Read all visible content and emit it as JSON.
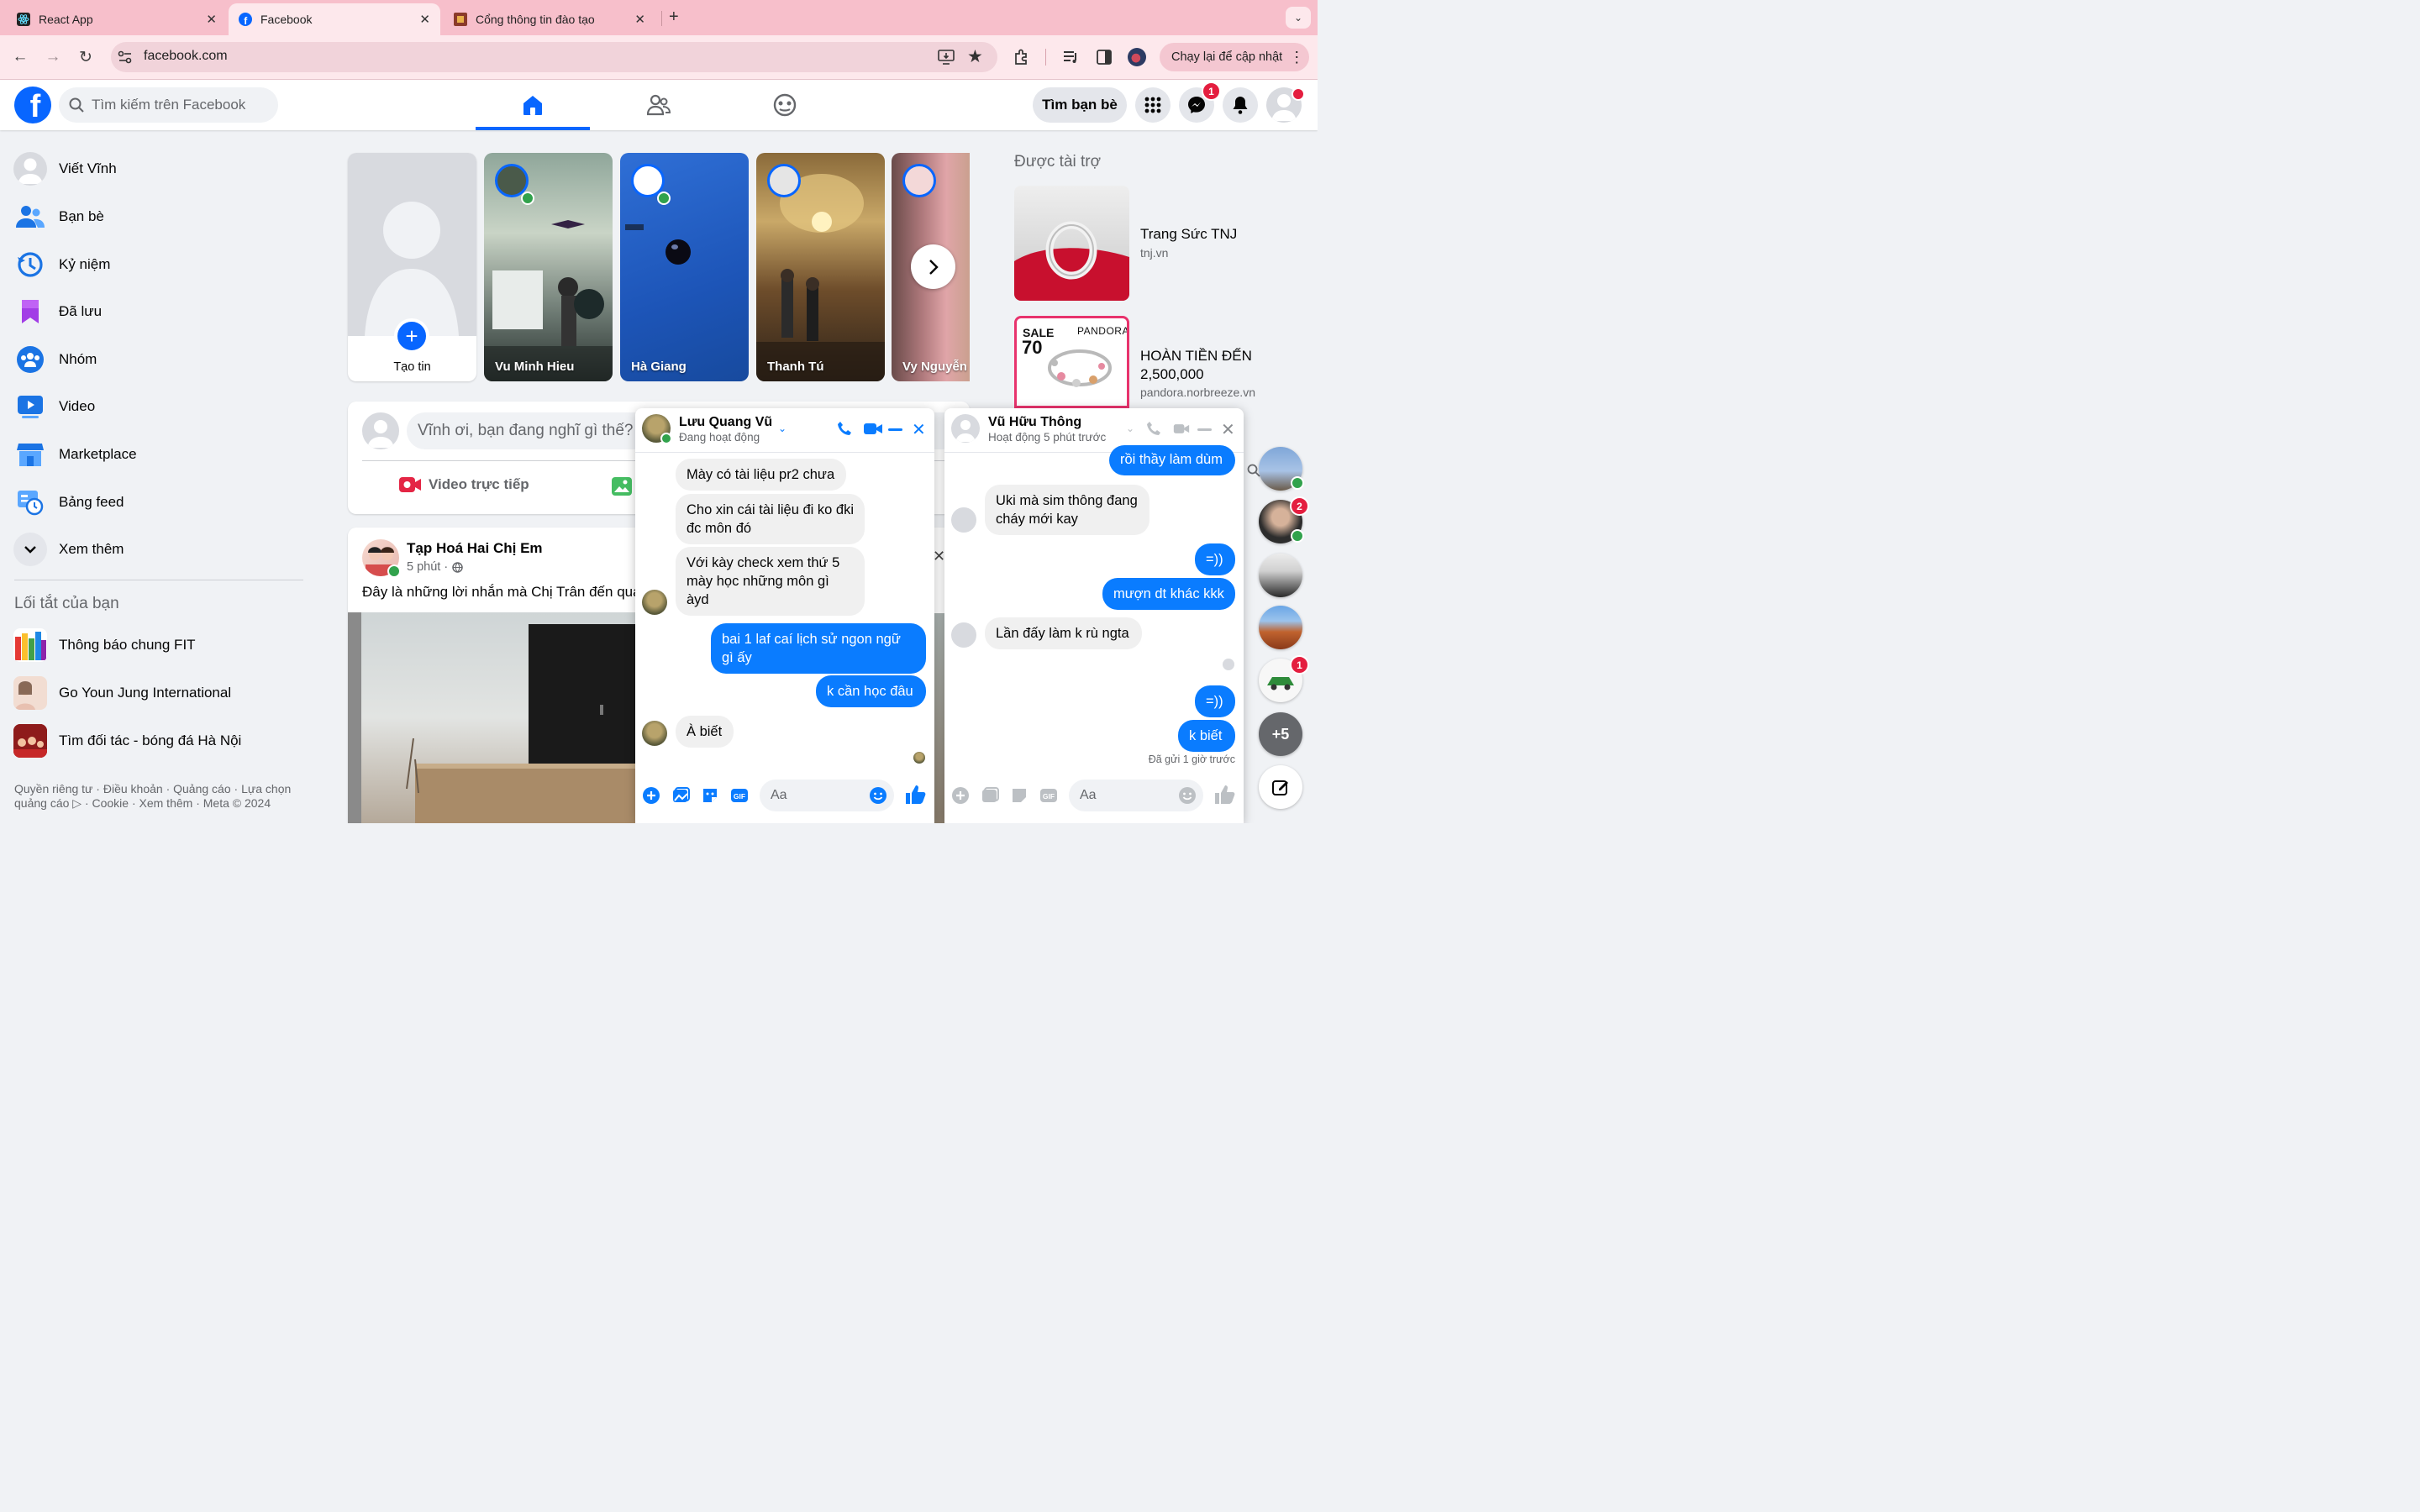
{
  "browser": {
    "tabs": [
      {
        "title": "React App",
        "active": false
      },
      {
        "title": "Facebook",
        "active": true
      },
      {
        "title": "Cổng thông tin đào tạo",
        "active": false
      }
    ],
    "url": "facebook.com",
    "relaunch_label": "Chạy lại để cập nhật"
  },
  "header": {
    "search_placeholder": "Tìm kiếm trên Facebook",
    "find_friends_label": "Tìm bạn bè",
    "messenger_badge": "1",
    "accent": "#0866ff"
  },
  "sidebar": {
    "items": [
      {
        "label": "Viết Vĩnh",
        "icon": "avatar"
      },
      {
        "label": "Bạn bè",
        "icon": "friends-icon"
      },
      {
        "label": "Kỷ niệm",
        "icon": "memories-icon"
      },
      {
        "label": "Đã lưu",
        "icon": "saved-icon"
      },
      {
        "label": "Nhóm",
        "icon": "groups-icon"
      },
      {
        "label": "Video",
        "icon": "video-icon"
      },
      {
        "label": "Marketplace",
        "icon": "marketplace-icon"
      },
      {
        "label": "Bảng feed",
        "icon": "feeds-icon"
      },
      {
        "label": "Xem thêm",
        "icon": "chevron-down-icon"
      }
    ],
    "shortcuts_title": "Lối tắt của bạn",
    "shortcuts": [
      {
        "label": "Thông báo chung FIT"
      },
      {
        "label": "Go Youn Jung International"
      },
      {
        "label": "Tìm đối tác - bóng đá Hà Nội"
      }
    ],
    "footer_line1": "Quyền riêng tư · Điều khoản · Quảng cáo · Lựa chọn",
    "footer_line2": "quảng cáo ▷ · Cookie · Xem thêm · Meta © 2024"
  },
  "stories": {
    "create_label": "Tạo tin",
    "items": [
      {
        "name": "Vu Minh Hieu"
      },
      {
        "name": "Hà Giang"
      },
      {
        "name": "Thanh Tú"
      },
      {
        "name": "Vy Nguyễn"
      }
    ]
  },
  "composer": {
    "placeholder": "Vĩnh ơi, bạn đang nghĩ gì thế?",
    "live_label": "Video trực tiếp"
  },
  "post": {
    "author": "Tạp Hoá Hai Chị Em",
    "time": "5 phút ·",
    "text": "Đây là những lời nhắn mà Chị Trân đến quán"
  },
  "sponsored": {
    "title": "Được tài trợ",
    "ads": [
      {
        "name": "Trang Sức TNJ",
        "domain": "tnj.vn"
      },
      {
        "name_line1": "HOÀN TIỀN ĐẾN",
        "name_line2": "2,500,000",
        "domain": "pandora.norbreeze.vn",
        "brand": "PANDORA",
        "sale": "SALE",
        "percent": "70"
      }
    ]
  },
  "chat1": {
    "name": "Lưu Quang Vũ",
    "status": "Đang hoạt động",
    "messages": [
      {
        "text": "Mày có tài liệu pr2 chưa",
        "from": "them"
      },
      {
        "text": "Cho xin cái tài liệu đi ko đki đc môn đó",
        "from": "them"
      },
      {
        "text": "Với kày check xem thứ 5 mày học những môn gì àyd",
        "from": "them"
      },
      {
        "text": "bai 1 laf caí lịch sử ngon ngữ gì ấy",
        "from": "me"
      },
      {
        "text": "k cần học đâu",
        "from": "me"
      },
      {
        "text": "À biết",
        "from": "them"
      }
    ],
    "input_placeholder": "Aa"
  },
  "chat2": {
    "name": "Vũ Hữu Thông",
    "status": "Hoạt động 5 phút trước",
    "messages": [
      {
        "text": "rồi thầy làm dùm",
        "from": "me"
      },
      {
        "text": "Uki mà sim thông đang cháy mới kay",
        "from": "them"
      },
      {
        "text": "=))",
        "from": "me"
      },
      {
        "text": "mượn dt khác kkk",
        "from": "me"
      },
      {
        "text": "Lần đấy làm k rù ngta",
        "from": "them"
      },
      {
        "text": "=))",
        "from": "me"
      },
      {
        "text": "k biết",
        "from": "me"
      }
    ],
    "sent_note": "Đã gửi 1 giờ trước",
    "input_placeholder": "Aa"
  },
  "chat_heads": {
    "badges": [
      "2",
      "1"
    ],
    "more_label": "+5"
  }
}
